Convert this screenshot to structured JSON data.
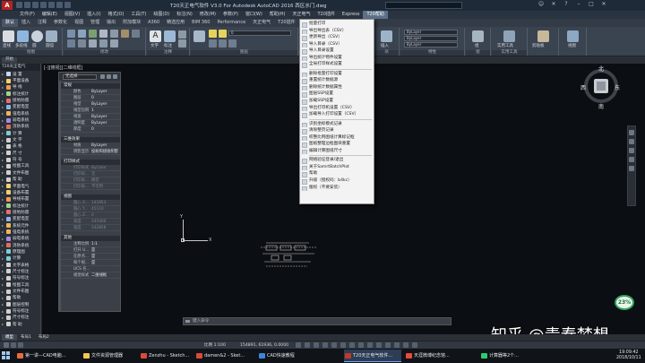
{
  "title_bar": {
    "app_logo": "A",
    "window_title": "T20天正电气软件 V3.0 For Autodesk AutoCAD 2016    西区水门.dwg"
  },
  "menubar": [
    {
      "label": "文件(F)"
    },
    {
      "label": "编辑(E)"
    },
    {
      "label": "视图(V)"
    },
    {
      "label": "插入(I)"
    },
    {
      "label": "格式(O)"
    },
    {
      "label": "工具(T)"
    },
    {
      "label": "绘图(D)"
    },
    {
      "label": "标注(N)"
    },
    {
      "label": "修改(M)"
    },
    {
      "label": "参数(P)"
    },
    {
      "label": "窗口(W)"
    },
    {
      "label": "帮助(H)"
    },
    {
      "label": "天正电气"
    },
    {
      "label": "T20插件"
    },
    {
      "label": "Express"
    },
    {
      "label": "T20帮助"
    }
  ],
  "ribbon_tabs": [
    {
      "label": "默认"
    },
    {
      "label": "插入"
    },
    {
      "label": "注释"
    },
    {
      "label": "参数化"
    },
    {
      "label": "视图"
    },
    {
      "label": "管理"
    },
    {
      "label": "输出"
    },
    {
      "label": "附加模块"
    },
    {
      "label": "A360"
    },
    {
      "label": "精选应用"
    },
    {
      "label": "BIM 360"
    },
    {
      "label": "Performance"
    },
    {
      "label": "天正电气"
    },
    {
      "label": "T20插件"
    }
  ],
  "ribbon": {
    "draw_buttons": [
      "直线",
      "多段线",
      "圆",
      "圆弧"
    ],
    "text_button": "文字",
    "dim_button": "标注",
    "layer_combo": "0",
    "insert_button": "插入",
    "bylayer_1": "ByLayer",
    "bylayer_2": "ByLayer",
    "bylayer_3": "ByLayer",
    "group_button": "组",
    "utilities_button": "实用工具",
    "clipboard_button": "剪贴板",
    "view_button": "视图",
    "panel_labels": [
      "绘图",
      "修改",
      "注释",
      "图层",
      "块",
      "特性",
      "组",
      "实用工具"
    ]
  },
  "file_tab": "开始",
  "side_panel": {
    "title": "T20天正电气",
    "items": [
      {
        "label": "设    置",
        "color": "#c8d9f0"
      },
      {
        "label": "平面设备",
        "color": "#f2d16b"
      },
      {
        "label": "导    线",
        "color": "#f09a5a"
      },
      {
        "label": "标注统计",
        "color": "#9fd28a"
      },
      {
        "label": "接地防雷",
        "color": "#e37070"
      },
      {
        "label": "变配电室",
        "color": "#8ab4e8"
      },
      {
        "label": "强电系统",
        "color": "#f0b45a"
      },
      {
        "label": "弱电系统",
        "color": "#a88ae0"
      },
      {
        "label": "消防系统",
        "color": "#e0705a"
      },
      {
        "label": "计    算",
        "color": "#7ecbd0"
      },
      {
        "label": "文    字",
        "color": "#d0d0d0"
      },
      {
        "label": "表    格",
        "color": "#d0d0d0"
      },
      {
        "label": "尺    寸",
        "color": "#d0d0d0"
      },
      {
        "label": "符    号",
        "color": "#d0d0d0"
      },
      {
        "label": "绘图工具",
        "color": "#d0d0d0"
      },
      {
        "label": "文件布图",
        "color": "#d0d0d0"
      },
      {
        "label": "帮    助",
        "color": "#d0d0d0"
      },
      {
        "label": "平面电气",
        "color": "#f2d16b"
      },
      {
        "label": "设备布置",
        "color": "#f2d16b"
      },
      {
        "label": "导线布置",
        "color": "#f09a5a"
      },
      {
        "label": "标注统计",
        "color": "#9fd28a"
      },
      {
        "label": "接地防雷",
        "color": "#e37070"
      },
      {
        "label": "变配电室",
        "color": "#8ab4e8"
      },
      {
        "label": "系统元件",
        "color": "#f0b45a"
      },
      {
        "label": "强电系统",
        "color": "#f0b45a"
      },
      {
        "label": "弱电系统",
        "color": "#a88ae0"
      },
      {
        "label": "消防系统",
        "color": "#e0705a"
      },
      {
        "label": "原理图",
        "color": "#7ecbd0"
      },
      {
        "label": "计算",
        "color": "#7ecbd0"
      },
      {
        "label": "文字表格",
        "color": "#d0d0d0"
      },
      {
        "label": "尺寸标注",
        "color": "#d0d0d0"
      },
      {
        "label": "符号标注",
        "color": "#d0d0d0"
      },
      {
        "label": "绘图工具",
        "color": "#d0d0d0"
      },
      {
        "label": "文件布图",
        "color": "#d0d0d0"
      },
      {
        "label": "帮助",
        "color": "#d0d0d0"
      },
      {
        "label": "图层控制",
        "color": "#d0d0d0"
      },
      {
        "label": "符号标注",
        "color": "#d0d0d0"
      },
      {
        "label": "尺寸标注",
        "color": "#d0d0d0"
      },
      {
        "label": "帮   助",
        "color": "#d0d0d0"
      }
    ]
  },
  "viewport_label": "[-][俯视][二维线框]",
  "properties": {
    "selection_combo": "无选择",
    "sections": [
      {
        "title": "常规",
        "rows": [
          {
            "k": "颜色",
            "v": "ByLayer"
          },
          {
            "k": "图层",
            "v": "0"
          },
          {
            "k": "线型",
            "v": "ByLayer"
          },
          {
            "k": "线型比例",
            "v": "1"
          },
          {
            "k": "线宽",
            "v": "ByLayer"
          },
          {
            "k": "透明度",
            "v": "ByLayer"
          },
          {
            "k": "厚度",
            "v": "0"
          }
        ]
      },
      {
        "title": "三维效果",
        "rows": [
          {
            "k": "材质",
            "v": "ByLayer"
          },
          {
            "k": "阴影显示",
            "v": "投射和接收阴影"
          }
        ]
      },
      {
        "title": "打印样式",
        "rows": [
          {
            "k": "打印样式",
            "v": "ByColor",
            "dim": true
          },
          {
            "k": "打印样...",
            "v": "无",
            "dim": true
          },
          {
            "k": "打印表...",
            "v": "模型",
            "dim": true
          },
          {
            "k": "打印表...",
            "v": "不可用",
            "dim": true
          }
        ]
      },
      {
        "title": "视图",
        "rows": [
          {
            "k": "圆心 X...",
            "v": "141853",
            "dim": true
          },
          {
            "k": "圆心 Y...",
            "v": "45110",
            "dim": true
          },
          {
            "k": "圆心 Z...",
            "v": "0",
            "dim": true
          },
          {
            "k": "高度",
            "v": "245400",
            "dim": true
          },
          {
            "k": "宽度",
            "v": "542858",
            "dim": true
          }
        ]
      },
      {
        "title": "其他",
        "rows": [
          {
            "k": "注释比例",
            "v": "1:1"
          },
          {
            "k": "打开 U...",
            "v": "是"
          },
          {
            "k": "在原点...",
            "v": "是"
          },
          {
            "k": "每个视...",
            "v": "是"
          },
          {
            "k": "UCS 名...",
            "v": ""
          },
          {
            "k": "视觉样式",
            "v": "二维线框"
          }
        ]
      }
    ]
  },
  "ucs": {
    "x_label": "X",
    "y_label": "Y"
  },
  "viewcube": {
    "north": "北",
    "south": "南",
    "east": "东",
    "west": "西"
  },
  "command_line": {
    "placeholder": "键入命令"
  },
  "perf_widget": "23%",
  "layout_tabs": [
    {
      "label": "模型"
    },
    {
      "label": "布局1"
    },
    {
      "label": "布局2"
    }
  ],
  "status": {
    "scale": "比例 1:100",
    "coords": "154891, 61936, 0.0000"
  },
  "t20_menu": {
    "items": [
      {
        "label": "批量打印"
      },
      {
        "label": "导出导出表（CSV）"
      },
      {
        "label": "更新导出（CSV）"
      },
      {
        "label": "导入目录（CSV）"
      },
      {
        "label": "导入目录设置"
      },
      {
        "label": "导出统计物件设置"
      },
      {
        "label": "全局打印样式设置"
      },
      {
        "sep": true
      },
      {
        "label": "删除批量打印设置"
      },
      {
        "label": "重置统计数据源"
      },
      {
        "label": "删除统计数据属性"
      },
      {
        "label": "图层SSP设置"
      },
      {
        "label": "加载SSP设置"
      },
      {
        "label": "导出打印机设置（CSV）"
      },
      {
        "label": "加载导入打印设置（CSV）"
      },
      {
        "sep": true
      },
      {
        "label": "识别坐标模式记录"
      },
      {
        "label": "清除整页记录"
      },
      {
        "label": "校整比例图纸计算标记框"
      },
      {
        "label": "图纸整理边框图块重置"
      },
      {
        "label": "编辑计算图纸尺寸"
      },
      {
        "sep": true
      },
      {
        "label": "网络验证登录/退出"
      },
      {
        "label": "关于SamrtBatchPlot"
      },
      {
        "label": "帮助"
      },
      {
        "label": "升级（授权码：b4kc）"
      },
      {
        "label": "版权（不要安装）"
      }
    ]
  },
  "taskbar": {
    "items": [
      {
        "label": "第一讲—CAD电脑...",
        "color": "#e86c3a"
      },
      {
        "label": "文件资源管理器",
        "color": "#f2c94c"
      },
      {
        "label": "Zenzhu - Sketch...",
        "color": "#d94b3b"
      },
      {
        "label": "damen&2 - Sket...",
        "color": "#d94b3b"
      },
      {
        "label": "CAD快速教程",
        "color": "#3b86d9"
      },
      {
        "label": "T20天正电气软件...",
        "color": "#c0392b"
      },
      {
        "label": "天涯微博纪念馆...",
        "color": "#e74c3c"
      },
      {
        "label": "计算器等2个...",
        "color": "#2ecc71"
      }
    ],
    "time": "19:09:42",
    "date": "2018/10/11"
  },
  "watermark": "知乎 @青春梦想"
}
